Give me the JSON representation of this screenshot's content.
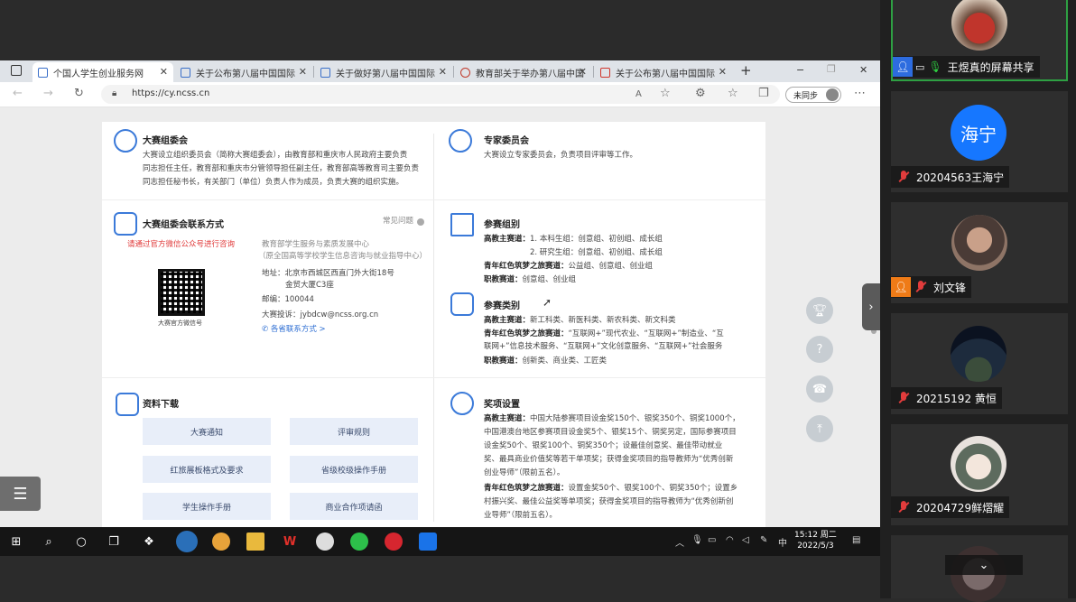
{
  "browser": {
    "tabs": [
      {
        "label": "个国人学生创业服务网",
        "active": true
      },
      {
        "label": "关于公布第八届中国国际"
      },
      {
        "label": "关于做好第八届中国国际"
      },
      {
        "label": "教育部关于举办第八届中国"
      },
      {
        "label": "关于公布第八届中国国际"
      }
    ],
    "new_tab": "+",
    "url": "https://cy.ncss.cn",
    "sync_label": "未同步",
    "window_min": "−",
    "window_restore": "❐",
    "window_close": "✕"
  },
  "page": {
    "committee": {
      "title": "大赛组委会",
      "text": [
        "大赛设立组织委员会（简称大赛组委会），由教育部和重庆市人民政府主要负责",
        "同志担任主任，教育部和重庆市分管领导担任副主任，教育部高等教育司主要负责",
        "同志担任秘书长，有关部门（单位）负责人作为成员，负责大赛的组织实施。"
      ]
    },
    "experts": {
      "title": "专家委员会",
      "text": "大赛设立专家委员会，负责项目评审等工作。"
    },
    "contact": {
      "title": "大赛组委会联系方式",
      "faq": "常见问题",
      "notice": "请通过官方微信公众号进行咨询",
      "qr_caption": "大赛官方微信号",
      "org": "教育部学生服务与素质发展中心",
      "org_sub": "（原全国高等学校学生信息咨询与就业指导中心）",
      "address_label": "地址：",
      "address": "北京市西城区西直门外大街18号",
      "address2": "金贸大厦C3座",
      "zip_label": "邮编：",
      "zip": "100044",
      "email_label": "大赛投诉：",
      "email": "jybdcw@ncss.org.cn",
      "more": "各省联系方式 >"
    },
    "groups": {
      "title": "参赛组别",
      "higher_label": "高教主赛道：",
      "higher_1": "1. 本科生组：创意组、初创组、成长组",
      "higher_2": "2. 研究生组：创意组、初创组、成长组",
      "red_label": "青年红色筑梦之旅赛道：",
      "red": "公益组、创意组、创业组",
      "voc_label": "职教赛道：",
      "voc": "创意组、创业组"
    },
    "categories": {
      "title": "参赛类别",
      "higher_label": "高教主赛道：",
      "higher": "新工科类、新医科类、新农科类、新文科类",
      "red_label": "青年红色筑梦之旅赛道：",
      "red_1": "“互联网+”现代农业、“互联网+”制造业、“互",
      "red_2": "联网+”信息技术服务、“互联网+”文化创意服务、“互联网+”社会服务",
      "voc_label": "职教赛道：",
      "voc": "创新类、商业类、工匠类"
    },
    "downloads": {
      "title": "资料下载",
      "buttons": [
        "大赛通知",
        "评审规则",
        "红旅展板格式及要求",
        "省级校级操作手册",
        "学生操作手册",
        "商业合作项请函"
      ]
    },
    "awards": {
      "title": "奖项设置",
      "higher_label": "高教主赛道：",
      "higher": [
        "中国大陆参赛项目设金奖150个、银奖350个、铜奖1000个，",
        "中国港澳台地区参赛项目设金奖5个、银奖15个、铜奖另定，国际参赛项目",
        "设金奖50个、银奖100个、铜奖350个；设最佳创意奖、最佳带动就业",
        "奖、最具商业价值奖等若干单项奖；获得金奖项目的指导教师为“优秀创新",
        "创业导师”（限前五名）。"
      ],
      "red_label": "青年红色筑梦之旅赛道：",
      "red": [
        "设置金奖50个、银奖100个、铜奖350个；设置乡",
        "村振兴奖、最佳公益奖等单项奖；获得金奖项目的指导教师为“优秀创新创",
        "业导师”（限前五名）。"
      ]
    }
  },
  "taskbar": {
    "time": "15:12 周二",
    "date": "2022/5/3",
    "ime": "中"
  },
  "meeting": {
    "participants": [
      {
        "name": "王煜真的屏幕共享",
        "sharing": true
      },
      {
        "name": "20204563王海宁",
        "avatar_text": "海宁"
      },
      {
        "name": "刘文锋"
      },
      {
        "name": "20215192 黄恒"
      },
      {
        "name": "20204729鲜熠耀"
      }
    ]
  },
  "colors": {
    "accent": "#3b7ad9",
    "notice_red": "#e03a3a",
    "meeting_blue": "#1677ff",
    "active_green": "#2ea043"
  }
}
